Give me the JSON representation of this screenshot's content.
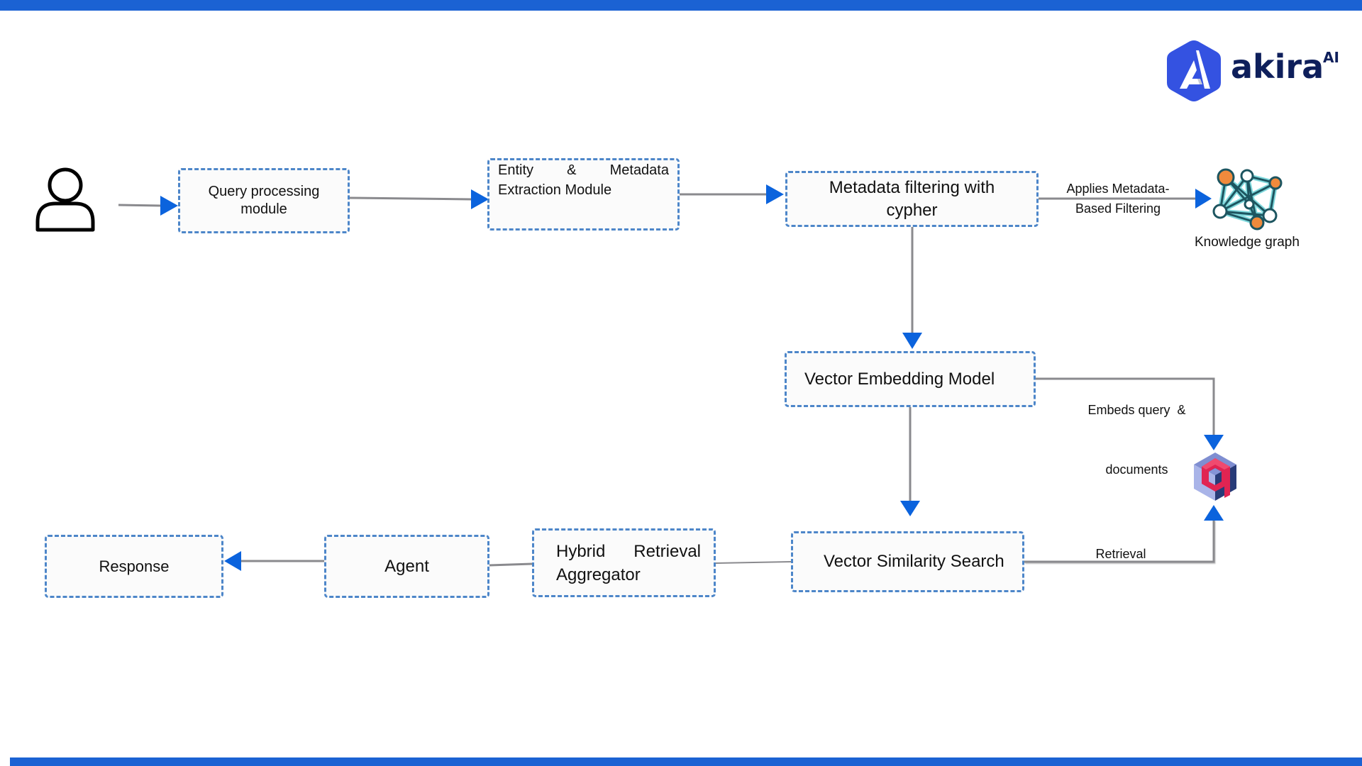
{
  "brand": {
    "name": "akira",
    "superscript": "AI",
    "color_primary": "#3452e1",
    "color_text": "#0e1f5b"
  },
  "theme": {
    "bar_color": "#1b62d3",
    "node_border": "#4d86c9",
    "node_fill": "#fbfbfb",
    "edge_color": "#8a8a8e",
    "arrow_color": "#0b63dd"
  },
  "nodes": {
    "user": {
      "icon": "user-icon"
    },
    "query": {
      "label": "Query processing module"
    },
    "entity": {
      "line1": "Entity & Metadata",
      "line2": "Extraction Module"
    },
    "metadata": {
      "label": "Metadata filtering with cypher"
    },
    "knowledge_graph": {
      "icon": "knowledge-graph-icon",
      "caption": "Knowledge graph"
    },
    "embedding": {
      "label": "Vector Embedding Model"
    },
    "vector_db": {
      "icon": "qdrant-icon"
    },
    "similarity": {
      "label": "Vector Similarity Search"
    },
    "hybrid": {
      "line1": "Hybrid Retrieval",
      "line2": "Aggregator"
    },
    "agent": {
      "label": "Agent"
    },
    "response": {
      "label": "Response"
    }
  },
  "edges": {
    "metadata_to_graph": {
      "line1": "Applies Metadata-",
      "line2": "Based Filtering"
    },
    "embedding_to_db": {
      "line1": "Embeds query  &",
      "line2": "documents"
    },
    "similarity_to_db": {
      "label": "Retrieval"
    }
  }
}
